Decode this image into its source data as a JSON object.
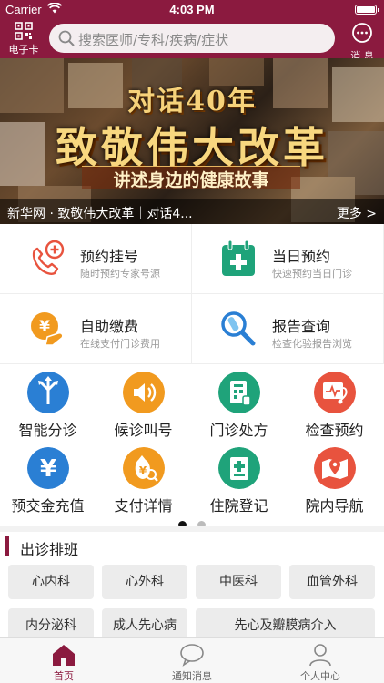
{
  "status_bar": {
    "carrier": "Carrier",
    "time": "4:03 PM"
  },
  "header": {
    "ecard_label": "电子卡",
    "search_placeholder": "搜索医师/专科/疾病/症状",
    "message_label": "消 息"
  },
  "banner": {
    "line1": "对话40年",
    "line2": "致敬伟大改革",
    "line3": "讲述身边的健康故事",
    "caption": "新华网 · 致敬伟大改革｜对话4...",
    "more": "更多 >"
  },
  "quick_actions": [
    {
      "title": "预约挂号",
      "subtitle": "随时预约专家号源",
      "icon": "phone-plus-icon"
    },
    {
      "title": "当日预约",
      "subtitle": "快速预约当日门诊",
      "icon": "calendar-cross-icon"
    },
    {
      "title": "自助缴费",
      "subtitle": "在线支付门诊费用",
      "icon": "yen-coin-hand-icon"
    },
    {
      "title": "报告查询",
      "subtitle": "检查化验报告浏览",
      "icon": "magnifier-testtube-icon"
    }
  ],
  "services": [
    {
      "label": "智能分诊",
      "icon": "triage-arrows-icon",
      "color": "#2a7fd4"
    },
    {
      "label": "候诊叫号",
      "icon": "speaker-icon",
      "color": "#f19a1f"
    },
    {
      "label": "门诊处方",
      "icon": "prescription-icon",
      "color": "#1fa37a"
    },
    {
      "label": "检查预约",
      "icon": "heart-monitor-icon",
      "color": "#e8533e"
    },
    {
      "label": "预交金充值",
      "icon": "yen-icon",
      "color": "#2a7fd4"
    },
    {
      "label": "支付详情",
      "icon": "money-bag-icon",
      "color": "#f19a1f"
    },
    {
      "label": "住院登记",
      "icon": "inpatient-form-icon",
      "color": "#1fa37a"
    },
    {
      "label": "院内导航",
      "icon": "map-pin-icon",
      "color": "#e8533e"
    }
  ],
  "schedule": {
    "title": "出诊排班",
    "departments": [
      "心内科",
      "心外科",
      "中医科",
      "血管外科",
      "内分泌科",
      "成人先心病",
      "先心及瓣膜病介入"
    ]
  },
  "tabs": [
    {
      "label": "首页",
      "icon": "home-icon",
      "active": true
    },
    {
      "label": "通知消息",
      "icon": "chat-bubble-icon",
      "active": false
    },
    {
      "label": "个人中心",
      "icon": "person-icon",
      "active": false
    }
  ],
  "colors": {
    "brand": "#8b1a3f"
  }
}
